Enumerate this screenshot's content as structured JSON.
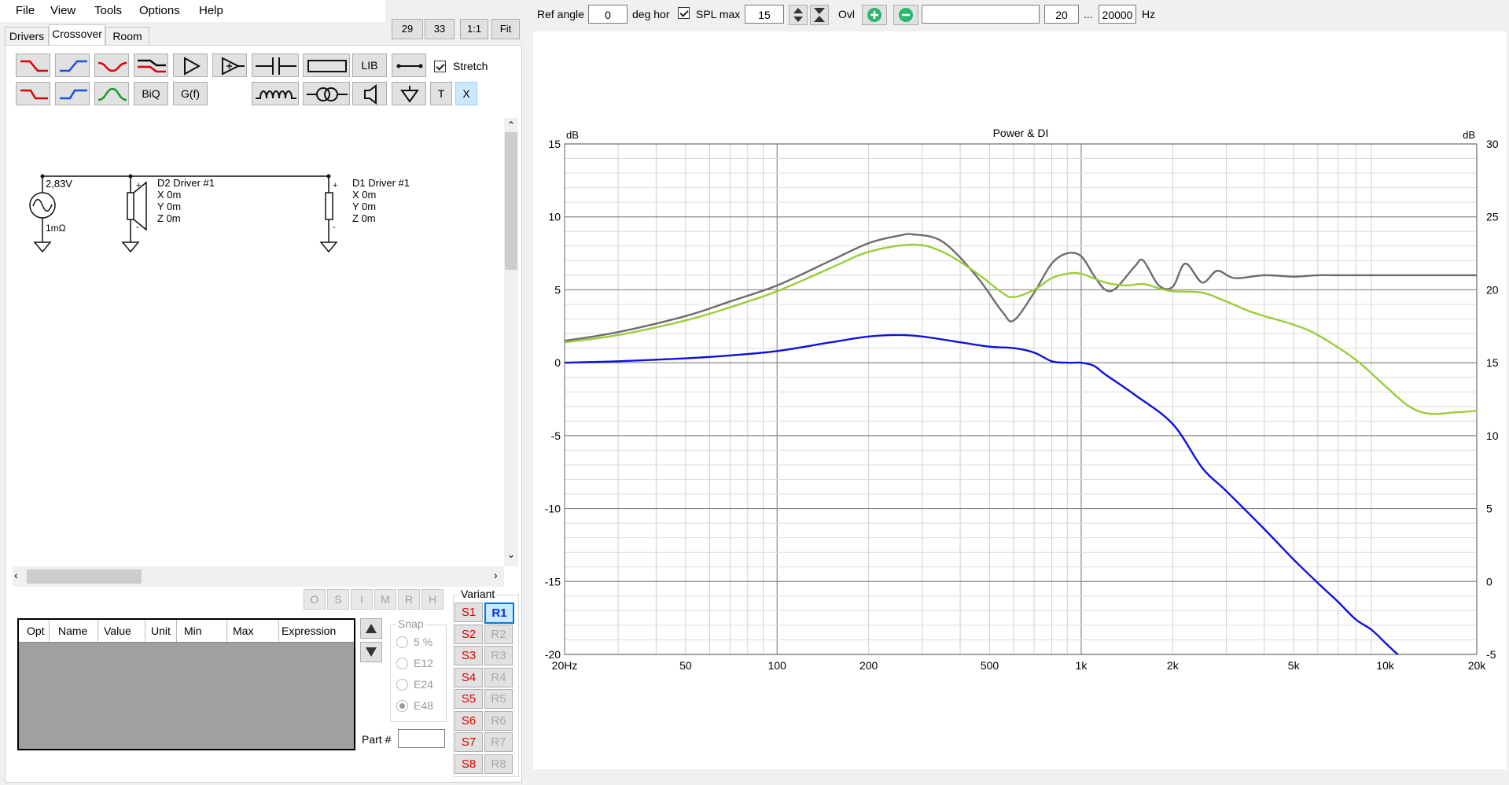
{
  "menu": [
    "File",
    "View",
    "Tools",
    "Options",
    "Help"
  ],
  "top_buttons": {
    "b29": "29",
    "b33": "33",
    "b11": "1:1",
    "fit": "Fit"
  },
  "tabs": [
    "Drivers",
    "Crossover",
    "Room"
  ],
  "active_tab": "Crossover",
  "toolbar": {
    "biq": "BiQ",
    "gf": "G(f)",
    "lib": "LIB",
    "t": "T",
    "x": "X",
    "stretch_label": "Stretch",
    "stretch_checked": true
  },
  "schematic": {
    "source_voltage": "2,83V",
    "source_impedance": "1mΩ",
    "d2": {
      "name": "D2 Driver #1",
      "x": "X 0m",
      "y": "Y 0m",
      "z": "Z 0m"
    },
    "d1": {
      "name": "D1 Driver #1",
      "x": "X 0m",
      "y": "Y 0m",
      "z": "Z 0m"
    }
  },
  "flags": [
    "O",
    "S",
    "I",
    "M",
    "R",
    "H"
  ],
  "parts_table": {
    "columns": [
      "Opt",
      "Name",
      "Value",
      "Unit",
      "Min",
      "Max",
      "Expression"
    ],
    "rows": []
  },
  "snap": {
    "label": "Snap",
    "options": [
      "5 %",
      "E12",
      "E24",
      "E48"
    ],
    "selected": "E48"
  },
  "part_label": "Part #",
  "part_value": "",
  "variant": {
    "label": "Variant",
    "s": [
      "S1",
      "S2",
      "S3",
      "S4",
      "S5",
      "S6",
      "S7",
      "S8"
    ],
    "r": [
      "R1",
      "R2",
      "R3",
      "R4",
      "R5",
      "R6",
      "R7",
      "R8"
    ],
    "selected": "R1"
  },
  "controls": {
    "ref_angle_label": "Ref angle",
    "ref_angle": "0",
    "deg_hor": "deg hor",
    "spl_max_label": "SPL max",
    "spl_max": "15",
    "spl_max_checked": true,
    "ovl": "Ovl",
    "overlay_name": "",
    "f_min": "20",
    "dots": "...",
    "f_max": "20000",
    "hz": "Hz"
  },
  "colors": {
    "gray": "#6d6d6d",
    "green": "#9acd3a",
    "blue": "#1010e0",
    "accent": "#0078d7",
    "red": "#e00000"
  },
  "chart_data": {
    "type": "line",
    "title": "Power & DI",
    "ylabel_left": "dB",
    "ylabel_right": "dB",
    "x_scale": "log",
    "xlim": [
      20,
      20000
    ],
    "ylim": [
      -20,
      15
    ],
    "ylim_right": [
      -5,
      30
    ],
    "x_ticks": [
      "20Hz",
      "50",
      "100",
      "200",
      "500",
      "1k",
      "2k",
      "5k",
      "10k",
      "20k"
    ],
    "y_ticks_left": [
      "15",
      "10",
      "5",
      "0",
      "-5",
      "-10",
      "-15",
      "-20"
    ],
    "y_ticks_right": [
      "30",
      "25",
      "20",
      "15",
      "10",
      "5",
      "0",
      "-5"
    ],
    "grid": true,
    "series": [
      {
        "color": "#6d6d6d",
        "axis": "left",
        "x": [
          20,
          30,
          50,
          70,
          100,
          150,
          200,
          250,
          280,
          350,
          450,
          550,
          600,
          700,
          800,
          900,
          1000,
          1100,
          1200,
          1300,
          1500,
          1600,
          1800,
          2000,
          2200,
          2500,
          2800,
          3200,
          4000,
          5000,
          6000,
          7000,
          10000,
          15000,
          20000
        ],
        "y": [
          1.5,
          2.1,
          3.2,
          4.2,
          5.3,
          7.0,
          8.2,
          8.7,
          8.8,
          8.3,
          6.0,
          3.5,
          2.9,
          4.8,
          6.8,
          7.5,
          7.3,
          6.0,
          5.0,
          5.1,
          6.6,
          7.0,
          5.3,
          5.2,
          6.8,
          5.5,
          6.3,
          5.8,
          6.0,
          5.9,
          6.0,
          6.0,
          6.0,
          6.0,
          6.0
        ]
      },
      {
        "color": "#9acd3a",
        "axis": "left",
        "x": [
          20,
          30,
          50,
          70,
          100,
          150,
          200,
          280,
          350,
          450,
          550,
          600,
          700,
          800,
          900,
          1000,
          1200,
          1400,
          1600,
          1800,
          2000,
          2500,
          3000,
          3500,
          4000,
          5000,
          6000,
          8000,
          10000,
          12000,
          14000,
          17000,
          20000
        ],
        "y": [
          1.4,
          1.9,
          2.9,
          3.8,
          4.9,
          6.5,
          7.6,
          8.1,
          7.6,
          6.2,
          4.8,
          4.5,
          5.0,
          5.8,
          6.1,
          6.1,
          5.5,
          5.3,
          5.4,
          5.1,
          4.9,
          4.8,
          4.2,
          3.6,
          3.2,
          2.6,
          1.9,
          0.2,
          -1.6,
          -3.0,
          -3.5,
          -3.4,
          -3.3
        ]
      },
      {
        "color": "#1010e0",
        "axis": "right",
        "x": [
          20,
          30,
          50,
          70,
          100,
          150,
          200,
          250,
          300,
          400,
          500,
          600,
          700,
          800,
          900,
          1000,
          1100,
          1200,
          1500,
          2000,
          2500,
          3000,
          4000,
          5000,
          6000,
          7000,
          8000,
          9000,
          10000,
          11000,
          12000
        ],
        "y": [
          15.0,
          15.1,
          15.3,
          15.5,
          15.8,
          16.4,
          16.8,
          16.9,
          16.8,
          16.4,
          16.1,
          16.0,
          15.7,
          15.1,
          15.0,
          15.0,
          14.8,
          14.2,
          12.8,
          10.8,
          7.8,
          6.2,
          3.6,
          1.5,
          -0.1,
          -1.4,
          -2.6,
          -3.3,
          -4.2,
          -5.0,
          -5.5
        ]
      }
    ]
  }
}
